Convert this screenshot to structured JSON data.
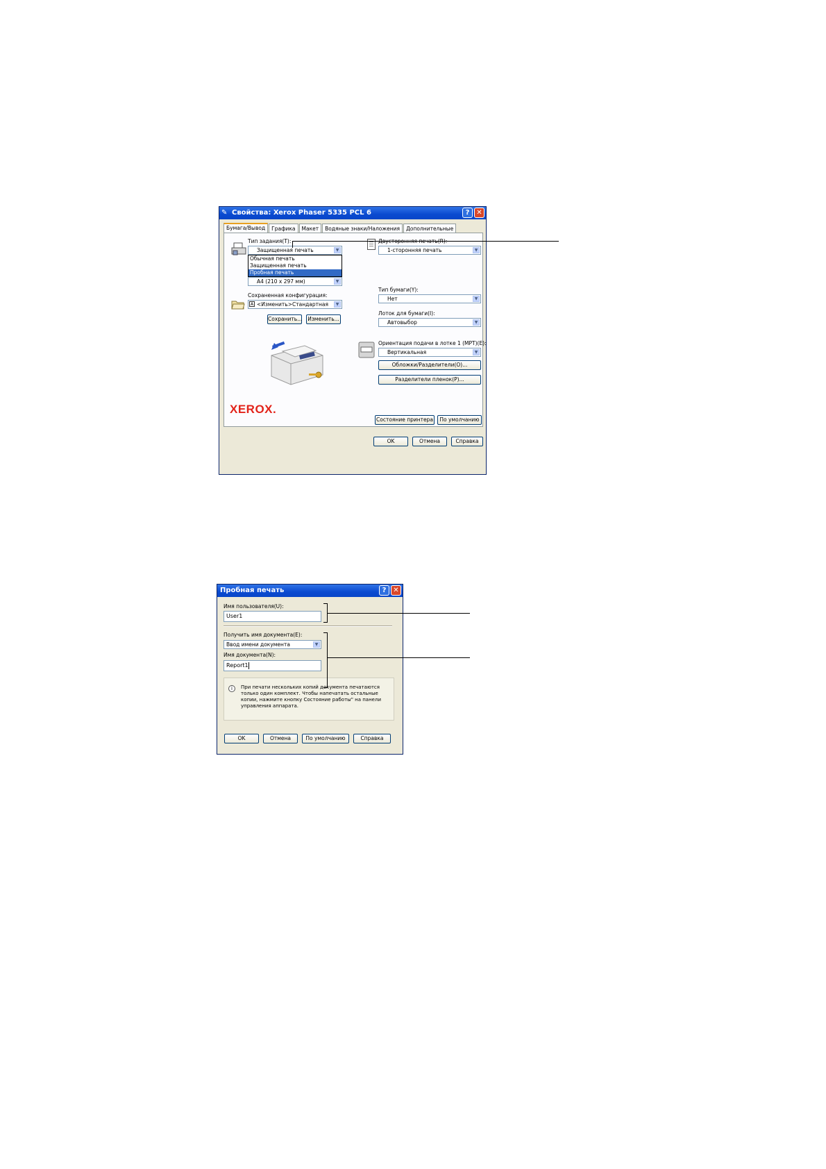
{
  "props_dialog": {
    "title": "Свойства: Xerox Phaser 5335 PCL 6",
    "help_btn": "?",
    "close_btn": "✕",
    "tabs": [
      "Бумага/Вывод",
      "Графика",
      "Макет",
      "Водяные знаки/Наложения",
      "Дополнительные"
    ],
    "job_type": {
      "label": "Тип задания(T):",
      "value": "Защищенная печать",
      "options": [
        "Обычная печать",
        "Защищенная печать",
        "Пробная печать"
      ],
      "selected_index": 2
    },
    "paper_size_value": "A4 (210 x 297 мм)",
    "saved_config": {
      "label": "Сохраненная конфигурация:",
      "value": "<Изменить>Стандартная",
      "save_btn": "Сохранить...",
      "edit_btn": "Изменить..."
    },
    "duplex": {
      "label": "Двусторонняя печать(R):",
      "value": "1-сторонняя печать"
    },
    "paper_type": {
      "label": "Тип бумаги(Y):",
      "value": "Нет"
    },
    "paper_tray": {
      "label": "Лоток для бумаги(I):",
      "value": "Автовыбор"
    },
    "mpt_orientation": {
      "label": "Ориентация подачи в лотке 1 (MPT)(E):",
      "value": "Вертикальная"
    },
    "covers_btn": "Обложки/Разделители(O)...",
    "transparency_btn": "Разделители пленок(P)...",
    "logo": "XEROX.",
    "printer_status_btn": "Состояние принтера",
    "defaults_btn": "По умолчанию",
    "ok_btn": "OK",
    "cancel_btn": "Отмена",
    "help_text_btn": "Справка"
  },
  "sample_dialog": {
    "title": "Пробная печать",
    "help_btn": "?",
    "close_btn": "✕",
    "user_name_label": "Имя пользователя(U):",
    "user_name_value": "User1",
    "get_doc_name_label": "Получить имя документа(E):",
    "get_doc_name_value": "Ввод имени документа",
    "doc_name_label": "Имя документа(N):",
    "doc_name_value": "Report1",
    "info_text": "При печати нескольких копий документа печатаются только один комплект. Чтобы напечатать остальные копии, нажмите кнопку Состояние работы\" на панели управления аппарата.",
    "ok_btn": "OK",
    "cancel_btn": "Отмена",
    "defaults_btn": "По умолчанию",
    "help_text_btn": "Справка"
  },
  "colors": {
    "title_blue": "#0a4ad0",
    "xerox_red": "#e2231a",
    "selection": "#316ac5"
  }
}
